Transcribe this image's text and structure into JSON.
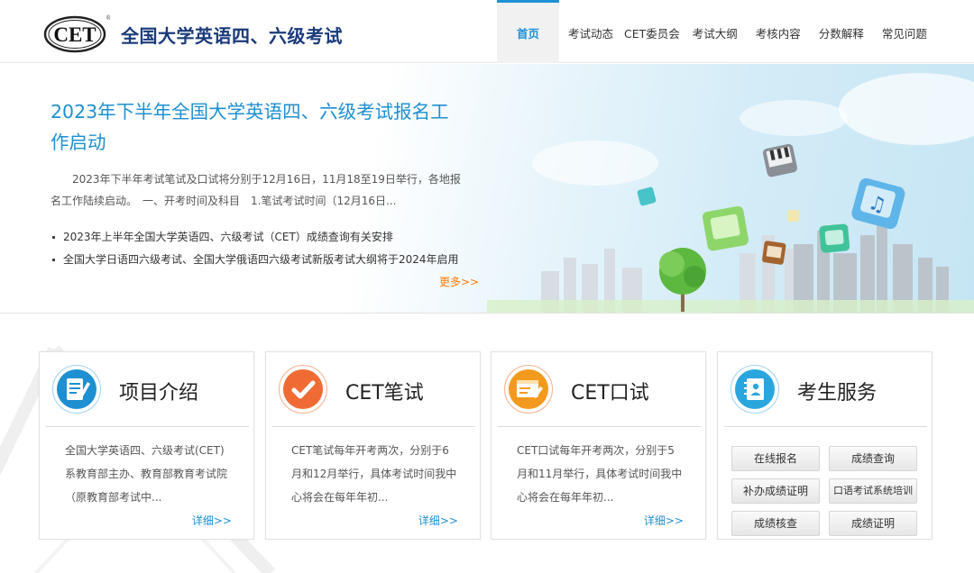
{
  "header": {
    "logo_text": "CET",
    "site_title": "全国大学英语四、六级考试",
    "nav": [
      {
        "label": "首页",
        "active": true
      },
      {
        "label": "考试动态"
      },
      {
        "label": "CET委员会"
      },
      {
        "label": "考试大纲"
      },
      {
        "label": "考核内容"
      },
      {
        "label": "分数解释"
      },
      {
        "label": "常见问题"
      }
    ]
  },
  "banner": {
    "headline": "2023年下半年全国大学英语四、六级考试报名工作启动",
    "summary": "2023年下半年考试笔试及口试将分别于12月16日，11月18至19日举行，各地报名工作陆续启动。　一、开考时间及科目　1.笔试考试时间（12月16日...",
    "news": [
      "2023年上半年全国大学英语四、六级考试（CET）成绩查询有关安排",
      "全国大学日语四六级考试、全国大学俄语四六级考试新版考试大纲将于2024年启用"
    ],
    "more": "更多>>"
  },
  "cards": [
    {
      "title": "项目介绍",
      "icon": "document-edit-icon",
      "text": "全国大学英语四、六级考试(CET)系教育部主办、教育部教育考试院（原教育部考试中...",
      "more": "详细>>"
    },
    {
      "title": "CET笔试",
      "icon": "checkmark-icon",
      "text": "CET笔试每年开考两次，分别于6月和12月举行，具体考试时间我中心将会在每年年初...",
      "more": "详细>>"
    },
    {
      "title": "CET口试",
      "icon": "screen-pen-icon",
      "text": "CET口试每年开考两次，分别于5月和11月举行，具体考试时间我中心将会在每年年初...",
      "more": "详细>>"
    },
    {
      "title": "考生服务",
      "icon": "contact-book-icon",
      "services": [
        "在线报名",
        "成绩查询",
        "补办成绩证明",
        "口语考试系统培训",
        "成绩核查",
        "成绩证明"
      ]
    }
  ],
  "colors": {
    "accent": "#1e8fd1",
    "more_link": "#ff7a00",
    "title_dark": "#1a3a7a"
  }
}
